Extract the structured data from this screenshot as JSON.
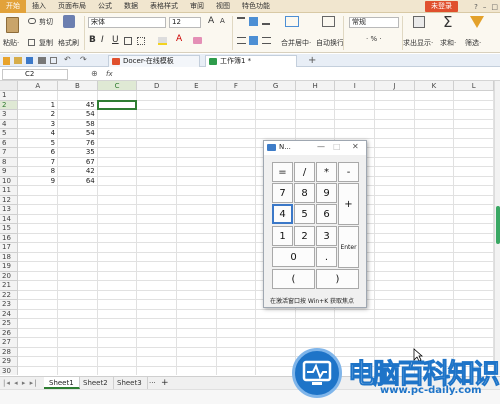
{
  "menubar": {
    "items": [
      "开始",
      "插入",
      "页面布局",
      "公式",
      "数据",
      "表格样式",
      "审阅",
      "视图",
      "特色功能"
    ],
    "login_label": "未登录"
  },
  "ribbon": {
    "paste_label": "粘贴·",
    "cut_label": "剪切",
    "copy_label": "复制",
    "format_painter_label": "格式刷",
    "font_name": "宋体",
    "font_size": "12",
    "bold": "B",
    "italic": "I",
    "underline": "U",
    "font_color_letter": "A",
    "grow_font": "A",
    "shrink_font": "A",
    "merge_label": "合并居中·",
    "wrap_label": "自动换行",
    "number_format": "常规",
    "percent": "·  %  ·",
    "freeze_label": "求出显示·",
    "sum_label": "求和·",
    "filter_label": "筛选·"
  },
  "tabbar": {
    "tabs": [
      {
        "label": "Docer-在线模板"
      },
      {
        "label": "工作簿1 *"
      }
    ]
  },
  "formula": {
    "cell_ref": "C2",
    "fx": "fx"
  },
  "grid": {
    "columns": [
      "A",
      "B",
      "C",
      "D",
      "E",
      "F",
      "G",
      "H",
      "I",
      "J",
      "K",
      "L"
    ],
    "rows": [
      {
        "n": "1",
        "a": "",
        "b": ""
      },
      {
        "n": "2",
        "a": "1",
        "b": "45"
      },
      {
        "n": "3",
        "a": "2",
        "b": "54"
      },
      {
        "n": "4",
        "a": "3",
        "b": "58"
      },
      {
        "n": "5",
        "a": "4",
        "b": "54"
      },
      {
        "n": "6",
        "a": "5",
        "b": "76"
      },
      {
        "n": "7",
        "a": "6",
        "b": "35"
      },
      {
        "n": "8",
        "a": "7",
        "b": "67"
      },
      {
        "n": "9",
        "a": "8",
        "b": "42"
      },
      {
        "n": "10",
        "a": "9",
        "b": "64"
      },
      {
        "n": "11"
      },
      {
        "n": "12"
      },
      {
        "n": "13"
      },
      {
        "n": "14"
      },
      {
        "n": "15"
      },
      {
        "n": "16"
      },
      {
        "n": "17"
      },
      {
        "n": "18"
      },
      {
        "n": "19"
      },
      {
        "n": "20"
      },
      {
        "n": "21"
      },
      {
        "n": "22"
      },
      {
        "n": "23"
      },
      {
        "n": "24"
      },
      {
        "n": "25"
      },
      {
        "n": "26"
      },
      {
        "n": "27"
      },
      {
        "n": "28"
      },
      {
        "n": "29"
      },
      {
        "n": "30"
      },
      {
        "n": "31"
      }
    ]
  },
  "sheets": {
    "tabs": [
      "Sheet1",
      "Sheet2",
      "Sheet3"
    ],
    "more": "···",
    "add": "+"
  },
  "calculator": {
    "title": "N...",
    "min": "—",
    "max": "□",
    "close": "✕",
    "keys": {
      "eq": "=",
      "div": "/",
      "mul": "*",
      "sub": "-",
      "k7": "7",
      "k8": "8",
      "k9": "9",
      "add": "+",
      "k4": "4",
      "k5": "5",
      "k6": "6",
      "k1": "1",
      "k2": "2",
      "k3": "3",
      "enter": "Enter",
      "k0": "0",
      "dot": ".",
      "lparen": "(",
      "rparen": ")"
    },
    "hint": "在激活窗口按 Win+K 获取焦点"
  },
  "watermark": {
    "text": "电脑百科知识",
    "url": "www.pc-daily.com"
  },
  "colors": {
    "accent": "#2e7d32",
    "menu_active": "#e2a23a",
    "login": "#e0502e",
    "watermark": "#1e74c8"
  }
}
